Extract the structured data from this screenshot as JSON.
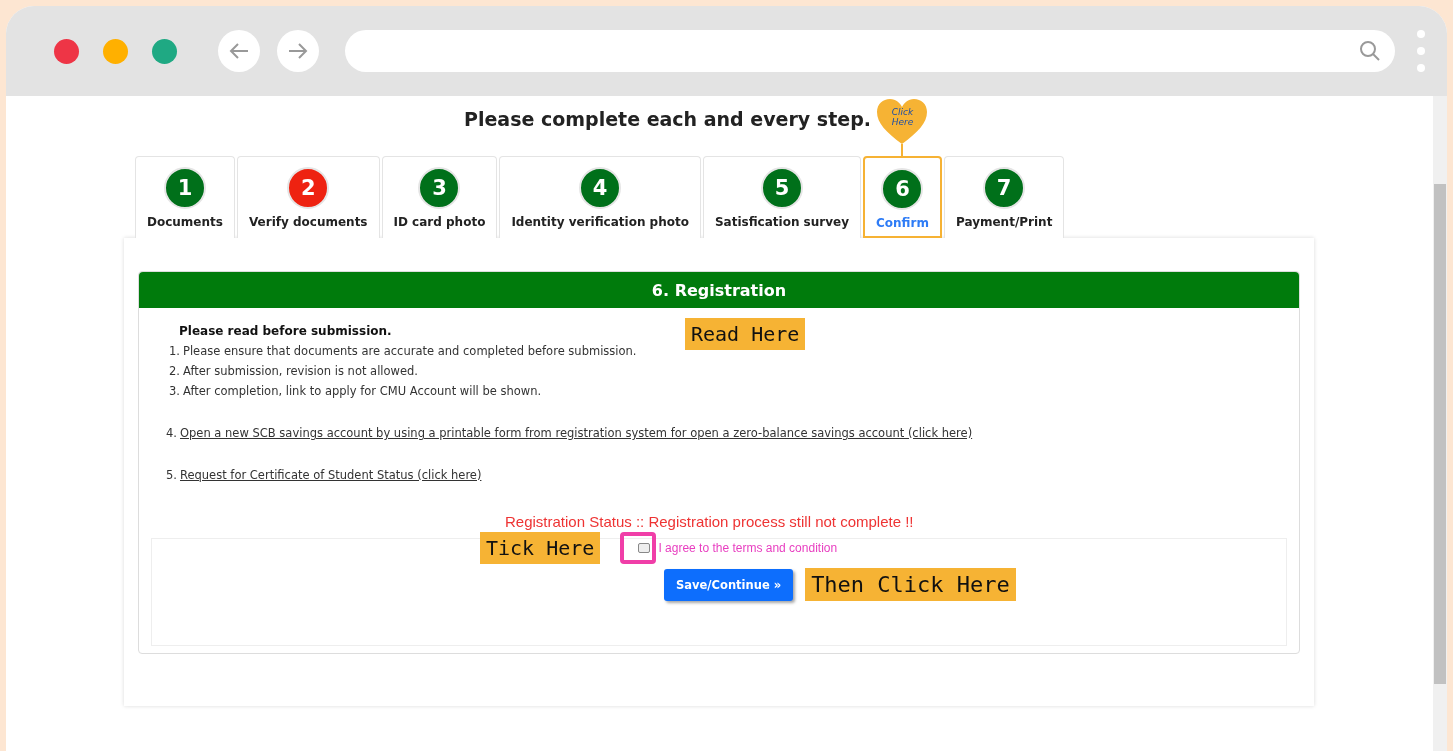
{
  "heading": "Please complete each and every step.",
  "callout": "Click Here",
  "tabs": [
    {
      "number": "1",
      "label": "Documents",
      "color": "#00701a",
      "selected": false
    },
    {
      "number": "2",
      "label": "Verify documents",
      "color": "#ee2211",
      "selected": false
    },
    {
      "number": "3",
      "label": "ID card photo",
      "color": "#00701a",
      "selected": false
    },
    {
      "number": "4",
      "label": "Identity verification photo",
      "color": "#00701a",
      "selected": false
    },
    {
      "number": "5",
      "label": "Satisfication survey",
      "color": "#00701a",
      "selected": false
    },
    {
      "number": "6",
      "label": "Confirm",
      "color": "#00701a",
      "selected": true
    },
    {
      "number": "7",
      "label": "Payment/Print",
      "color": "#00701a",
      "selected": false
    }
  ],
  "panel": {
    "title": "6. Registration",
    "notice_title": "Please read before submission.",
    "notes": [
      {
        "number": "1.",
        "text": "Please ensure that documents are accurate and completed before submission.",
        "kind": "text"
      },
      {
        "number": "2.",
        "text": "After submission, revision is not allowed.",
        "kind": "text"
      },
      {
        "number": "3.",
        "text": "After completion, link to apply for CMU Account will be shown.",
        "kind": "text"
      },
      {
        "number": "4.",
        "text": "Open a new SCB savings account by using a printable form from registration system for open a zero-balance savings account (click here)",
        "kind": "link"
      },
      {
        "number": "5.",
        "text": "Request for Certificate of Student Status (click here)",
        "kind": "link"
      }
    ],
    "status": "Registration Status :: Registration process still not complete !!",
    "agree": {
      "label": "I agree to the terms and condition",
      "checked": false
    },
    "button": "Save/Continue »"
  },
  "annotations": {
    "read": "Read Here",
    "tick": "Tick Here",
    "click": "Then Click Here"
  }
}
